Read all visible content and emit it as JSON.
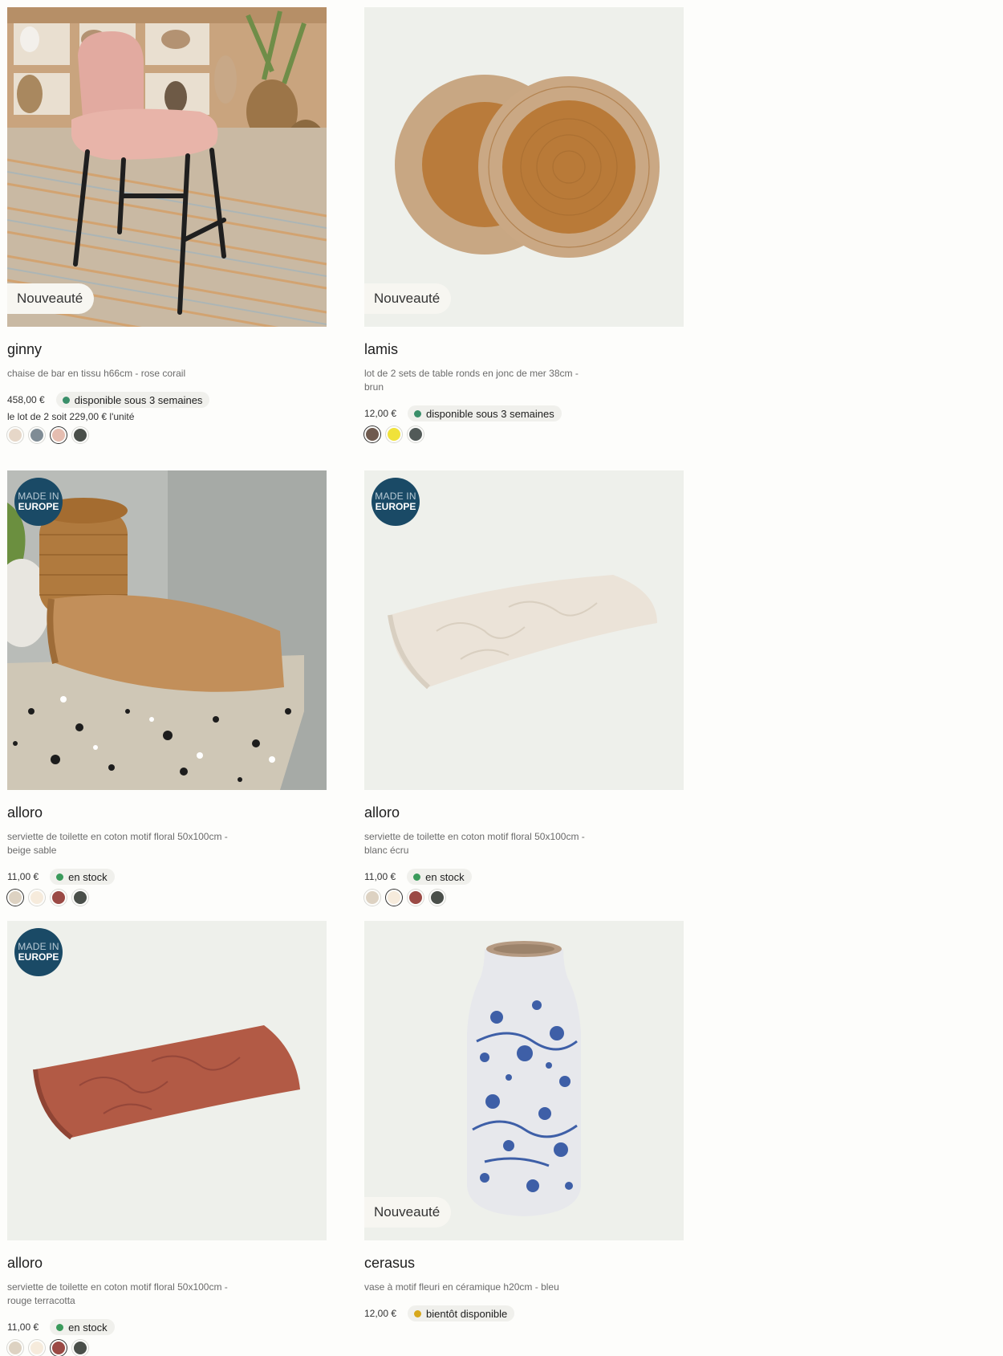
{
  "products": [
    {
      "badge": "Nouveauté",
      "name": "ginny",
      "desc": "chaise de bar en tissu h66cm - rose corail",
      "price": "458,00 €",
      "availability": "disponible sous 3 semaines",
      "availability_color": "#3a8f6a",
      "unit_price": "le lot de 2 soit 229,00 € l'unité",
      "swatches": [
        "#e6d7c8",
        "#7f8c95",
        "#e5bdb0",
        "#4a4f4a"
      ],
      "selected_swatch": 2
    },
    {
      "badge": "Nouveauté",
      "name": "lamis",
      "desc": "lot de 2 sets de table ronds en jonc de mer 38cm - brun",
      "price": "12,00 €",
      "availability": "disponible sous 3 semaines",
      "availability_color": "#3a8f6a",
      "swatches": [
        "#6f5a4e",
        "#f0e23a",
        "#525a58"
      ],
      "selected_swatch": 0
    },
    {
      "badge_eu_line1": "MADE IN",
      "badge_eu_line2": "EUROPE",
      "name": "alloro",
      "desc": "serviette de toilette en coton motif floral 50x100cm - beige sable",
      "price": "11,00 €",
      "availability": "en stock",
      "availability_color": "#3a9a5b",
      "swatches": [
        "#ddd2c2",
        "#f6ebdc",
        "#9b4a45",
        "#4a4f4a"
      ],
      "selected_swatch": 0
    },
    {
      "badge_eu_line1": "MADE IN",
      "badge_eu_line2": "EUROPE",
      "name": "alloro",
      "desc": "serviette de toilette en coton motif floral 50x100cm - blanc écru",
      "price": "11,00 €",
      "availability": "en stock",
      "availability_color": "#3a9a5b",
      "swatches": [
        "#ddd2c2",
        "#f6ebdc",
        "#9b4a45",
        "#4a4f4a"
      ],
      "selected_swatch": 1
    },
    {
      "badge_eu_line1": "MADE IN",
      "badge_eu_line2": "EUROPE",
      "name": "alloro",
      "desc": "serviette de toilette en coton motif floral 50x100cm - rouge terracotta",
      "price": "11,00 €",
      "availability": "en stock",
      "availability_color": "#3a9a5b",
      "swatches": [
        "#ddd2c2",
        "#f6ebdc",
        "#9b4a45",
        "#4a4f4a"
      ],
      "selected_swatch": 2
    },
    {
      "badge": "Nouveauté",
      "name": "cerasus",
      "desc": "vase à motif fleuri en céramique h20cm - bleu",
      "price": "12,00 €",
      "availability": "bientôt disponible",
      "availability_color": "#d7a81c"
    }
  ]
}
